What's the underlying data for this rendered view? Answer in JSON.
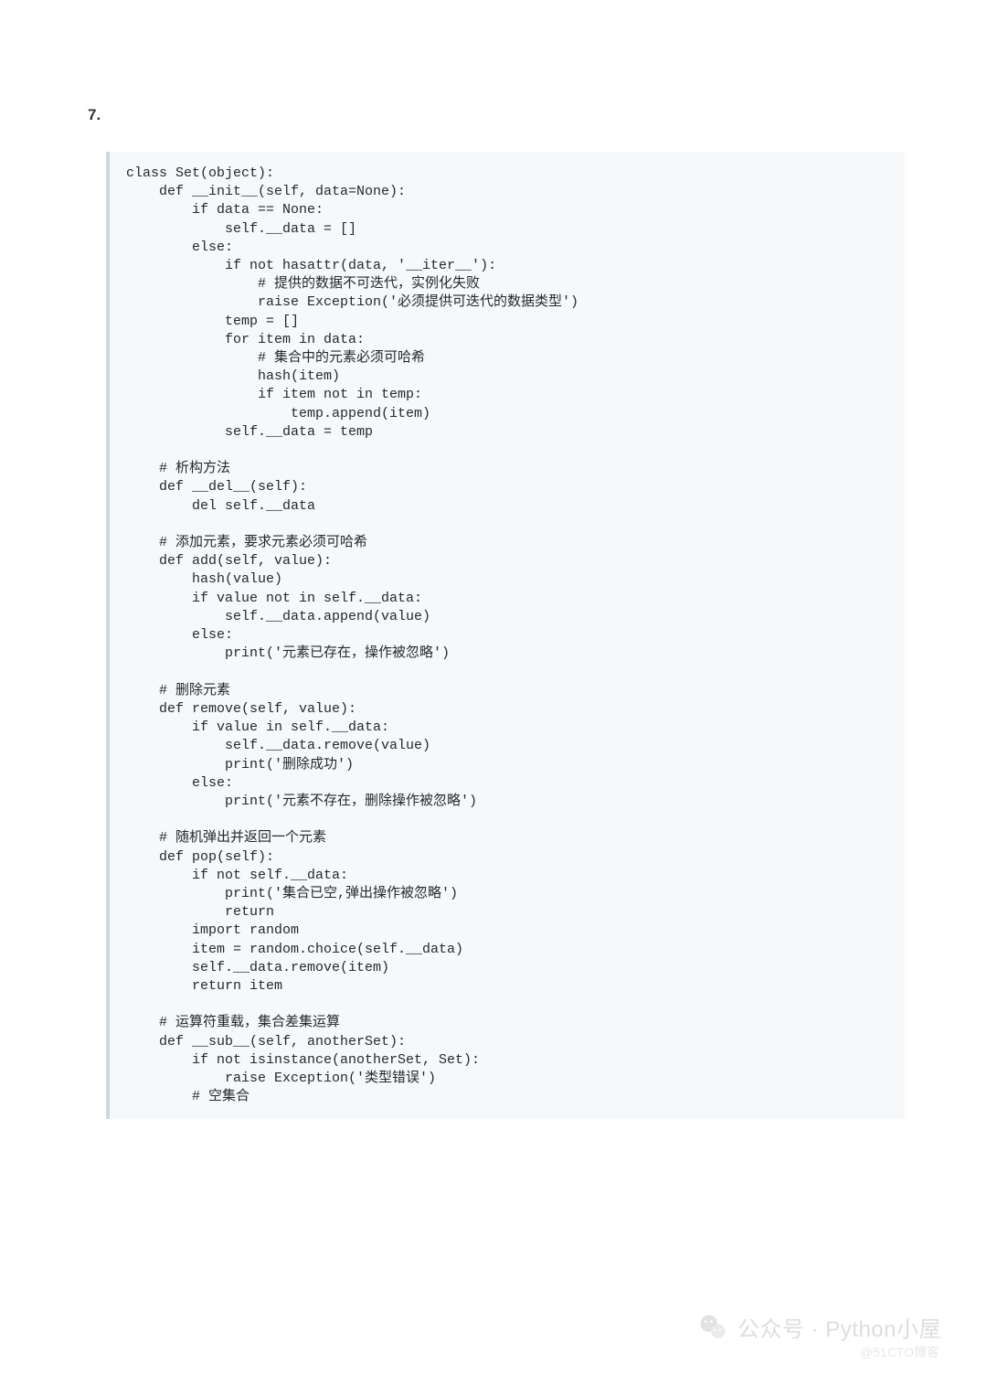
{
  "section": {
    "number": "7."
  },
  "code": {
    "lines": [
      "class Set(object):",
      "    def __init__(self, data=None):",
      "        if data == None:",
      "            self.__data = []",
      "        else:",
      "            if not hasattr(data, '__iter__'):",
      "                # 提供的数据不可迭代，实例化失败",
      "                raise Exception('必须提供可迭代的数据类型')",
      "            temp = []",
      "            for item in data:",
      "                # 集合中的元素必须可哈希",
      "                hash(item)",
      "                if item not in temp:",
      "                    temp.append(item)",
      "            self.__data = temp",
      "",
      "    # 析构方法",
      "    def __del__(self):",
      "        del self.__data",
      "",
      "    # 添加元素，要求元素必须可哈希",
      "    def add(self, value):",
      "        hash(value)",
      "        if value not in self.__data:",
      "            self.__data.append(value)",
      "        else:",
      "            print('元素已存在，操作被忽略')",
      "",
      "    # 删除元素",
      "    def remove(self, value):",
      "        if value in self.__data:",
      "            self.__data.remove(value)",
      "            print('删除成功')",
      "        else:",
      "            print('元素不存在，删除操作被忽略')",
      "",
      "    # 随机弹出并返回一个元素",
      "    def pop(self):",
      "        if not self.__data:",
      "            print('集合已空,弹出操作被忽略')",
      "            return",
      "        import random",
      "        item = random.choice(self.__data)",
      "        self.__data.remove(item)",
      "        return item",
      "",
      "    # 运算符重载，集合差集运算",
      "    def __sub__(self, anotherSet):",
      "        if not isinstance(anotherSet, Set):",
      "            raise Exception('类型错误')",
      "        # 空集合"
    ]
  },
  "watermark": {
    "main": "公众号 · Python小屋",
    "sub": "@51CTO博客"
  }
}
